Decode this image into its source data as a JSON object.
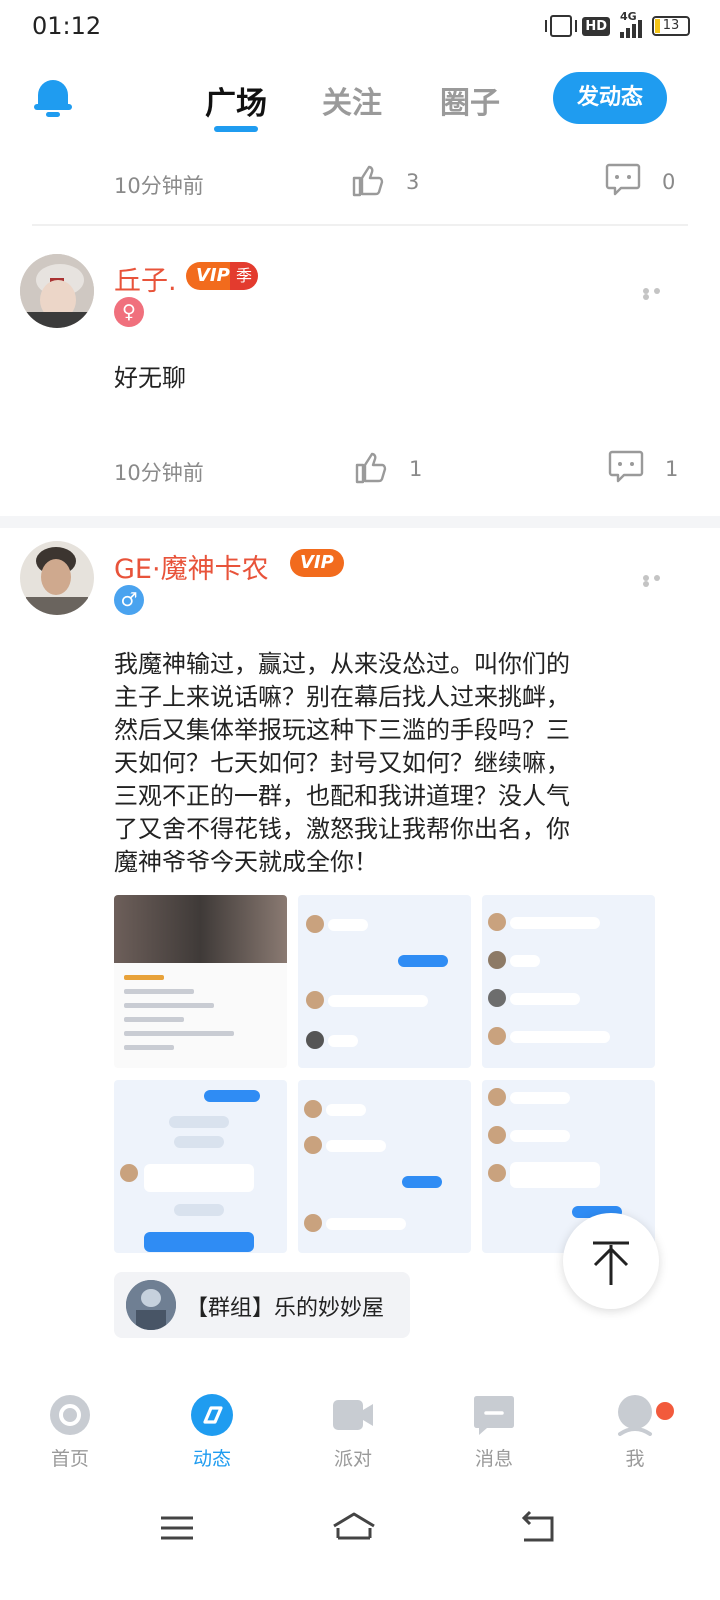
{
  "status_bar": {
    "time": "01:12",
    "hd_label": "HD",
    "network_label": "4G",
    "battery": "13"
  },
  "header": {
    "tabs": [
      {
        "label": "广场",
        "active": true
      },
      {
        "label": "关注",
        "active": false
      },
      {
        "label": "圈子",
        "active": false
      }
    ],
    "post_button": "发动态",
    "accent_color": "#1f9cf0"
  },
  "feed": {
    "posts": [
      {
        "time": "10分钟前",
        "likes": "3",
        "comments": "0"
      },
      {
        "username": "丘子.",
        "vip_badge": "VIP",
        "vip_season": "季",
        "gender": "♀",
        "text": "好无聊",
        "time": "10分钟前",
        "likes": "1",
        "comments": "1"
      },
      {
        "username": "GE·魔神卡农",
        "vip_badge": "VIP",
        "gender": "♂",
        "text_lines": [
          "我魔神输过，赢过，从来没怂过。叫你们的",
          "主子上来说话嘛？别在幕后找人过来挑衅，",
          "然后又集体举报玩这种下三滥的手段吗？三",
          "天如何？七天如何？封号又如何？继续嘛，",
          "三观不正的一群，也配和我讲道理？没人气",
          "了又舍不得花钱，激怒我让我帮你出名，你",
          "魔神爷爷今天就成全你！"
        ],
        "group": "【群组】乐的妙妙屋"
      }
    ]
  },
  "bottom_nav": {
    "items": [
      {
        "label": "首页",
        "icon": "home-icon"
      },
      {
        "label": "动态",
        "icon": "feed-icon",
        "active": true
      },
      {
        "label": "派对",
        "icon": "video-icon"
      },
      {
        "label": "消息",
        "icon": "message-icon"
      },
      {
        "label": "我",
        "icon": "profile-icon"
      }
    ]
  },
  "colors": {
    "accent": "#1f9cf0",
    "username": "#e8533a",
    "vip": "#f26b1d",
    "notification": "#f25a3c"
  }
}
